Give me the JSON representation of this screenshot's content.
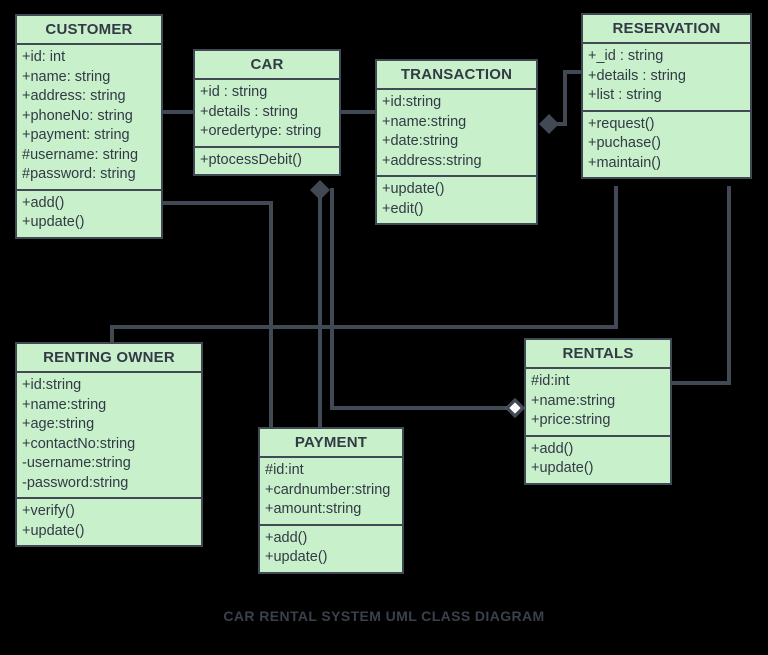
{
  "caption": "CAR RENTAL SYSTEM UML CLASS DIAGRAM",
  "colors": {
    "background": "#000000",
    "class_fill": "#c8f0cb",
    "stroke": "#414a54",
    "text": "#323a45",
    "hollow_diamond_fill": "#ffffff"
  },
  "classes": {
    "customer": {
      "name": "CUSTOMER",
      "attributes": [
        "+id: int",
        "+name: string",
        "+address: string",
        "+phoneNo: string",
        "+payment: string",
        "#username: string",
        "#password: string"
      ],
      "methods": [
        "+add()",
        "+update()"
      ]
    },
    "car": {
      "name": "CAR",
      "attributes": [
        "+id : string",
        "+details : string",
        "+oredertype: string"
      ],
      "methods": [
        "+ptocessDebit()"
      ]
    },
    "transaction": {
      "name": "TRANSACTION",
      "attributes": [
        "+id:string",
        "+name:string",
        "+date:string",
        "+address:string"
      ],
      "methods": [
        "+update()",
        "+edit()"
      ]
    },
    "reservation": {
      "name": "RESERVATION",
      "attributes": [
        "+_id : string",
        "+details : string",
        "+list : string"
      ],
      "methods": [
        "+request()",
        "+puchase()",
        "+maintain()"
      ]
    },
    "renting_owner": {
      "name": "RENTING OWNER",
      "attributes": [
        "+id:string",
        "+name:string",
        "+age:string",
        "+contactNo:string",
        "-username:string",
        "-password:string"
      ],
      "methods": [
        "+verify()",
        "+update()"
      ]
    },
    "payment": {
      "name": "PAYMENT",
      "attributes": [
        "#id:int",
        "+cardnumber:string",
        "+amount:string"
      ],
      "methods": [
        "+add()",
        "+update()"
      ]
    },
    "rentals": {
      "name": "RENTALS",
      "attributes": [
        "#id:int",
        "+name:string",
        "+price:string"
      ],
      "methods": [
        "+add()",
        "+update()"
      ]
    }
  },
  "relationships": [
    {
      "id": "customer-car",
      "from": "CUSTOMER",
      "to": "CAR",
      "marker": "none"
    },
    {
      "id": "car-transaction",
      "from": "CAR",
      "to": "TRANSACTION",
      "marker": "none"
    },
    {
      "id": "transaction-reservation",
      "from": "TRANSACTION",
      "to": "RESERVATION",
      "marker": "filled-diamond"
    },
    {
      "id": "customer-payment",
      "from": "CUSTOMER",
      "to": "PAYMENT",
      "marker": "none"
    },
    {
      "id": "car-payment",
      "from": "CAR",
      "to": "PAYMENT",
      "marker": "filled-diamond"
    },
    {
      "id": "car-rentals",
      "from": "CAR",
      "to": "RENTALS",
      "marker": "hollow-diamond"
    },
    {
      "id": "reservation-rentingowner",
      "from": "RESERVATION",
      "to": "RENTING OWNER",
      "marker": "none"
    },
    {
      "id": "reservation-rentals",
      "from": "RESERVATION",
      "to": "RENTALS",
      "marker": "none"
    }
  ]
}
